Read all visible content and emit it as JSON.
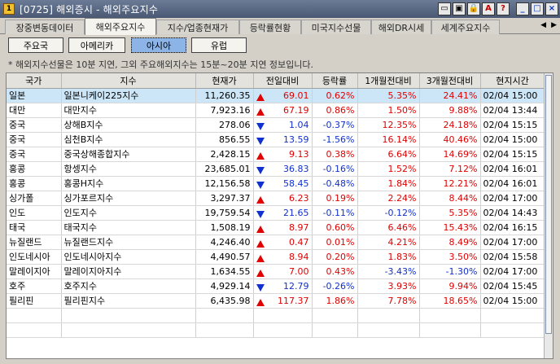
{
  "window": {
    "title": "[0725] 해외증시 - 해외주요지수",
    "icon_label": "1",
    "buttons": [
      "window-icon",
      "window-icon",
      "lock-icon",
      "a-icon",
      "help-icon",
      "minimize-icon",
      "maximize-icon",
      "close-icon"
    ]
  },
  "tabs": [
    {
      "label": "장중변동데이터"
    },
    {
      "label": "해외주요지수"
    },
    {
      "label": "지수/업종현재가"
    },
    {
      "label": "등락률현황"
    },
    {
      "label": "미국지수선물"
    },
    {
      "label": "해외DR시세"
    },
    {
      "label": "세계주요지수"
    }
  ],
  "tab_arrows": {
    "left": "◀",
    "right": "▶"
  },
  "regions": [
    {
      "label": "주요국"
    },
    {
      "label": "아메리카"
    },
    {
      "label": "아시아"
    },
    {
      "label": "유럽"
    }
  ],
  "notice": "* 해외지수선물은 10분 지연, 그외 주요해외지수는 15분~20분 지연 정보입니다.",
  "columns": [
    "국가",
    "지수",
    "현재가",
    "전일대비",
    "등락률",
    "1개월전대비",
    "3개월전대비",
    "현지시간"
  ],
  "rows": [
    {
      "country": "일본",
      "index": "일본니케이225지수",
      "price": "11,260.35",
      "dir": "up",
      "change": "69.01",
      "rate": "0.62%",
      "m1": "5.35%",
      "m3": "24.41%",
      "date": "02/04",
      "time": "15:00"
    },
    {
      "country": "대만",
      "index": "대만지수",
      "price": "7,923.16",
      "dir": "up",
      "change": "67.19",
      "rate": "0.86%",
      "m1": "1.50%",
      "m3": "9.88%",
      "date": "02/04",
      "time": "13:44"
    },
    {
      "country": "중국",
      "index": "상해B지수",
      "price": "278.06",
      "dir": "dn",
      "change": "1.04",
      "rate": "-0.37%",
      "m1": "12.35%",
      "m3": "24.18%",
      "date": "02/04",
      "time": "15:15"
    },
    {
      "country": "중국",
      "index": "심천B지수",
      "price": "856.55",
      "dir": "dn",
      "change": "13.59",
      "rate": "-1.56%",
      "m1": "16.14%",
      "m3": "40.46%",
      "date": "02/04",
      "time": "15:00"
    },
    {
      "country": "중국",
      "index": "중국상해종합지수",
      "price": "2,428.15",
      "dir": "up",
      "change": "9.13",
      "rate": "0.38%",
      "m1": "6.64%",
      "m3": "14.69%",
      "date": "02/04",
      "time": "15:15"
    },
    {
      "country": "홍콩",
      "index": "항셍지수",
      "price": "23,685.01",
      "dir": "dn",
      "change": "36.83",
      "rate": "-0.16%",
      "m1": "1.52%",
      "m3": "7.12%",
      "date": "02/04",
      "time": "16:01"
    },
    {
      "country": "홍콩",
      "index": "홍콩H지수",
      "price": "12,156.58",
      "dir": "dn",
      "change": "58.45",
      "rate": "-0.48%",
      "m1": "1.84%",
      "m3": "12.21%",
      "date": "02/04",
      "time": "16:01"
    },
    {
      "country": "싱가폴",
      "index": "싱가포르지수",
      "price": "3,297.37",
      "dir": "up",
      "change": "6.23",
      "rate": "0.19%",
      "m1": "2.24%",
      "m3": "8.44%",
      "date": "02/04",
      "time": "17:00"
    },
    {
      "country": "인도",
      "index": "인도지수",
      "price": "19,759.54",
      "dir": "dn",
      "change": "21.65",
      "rate": "-0.11%",
      "m1": "-0.12%",
      "m3": "5.35%",
      "date": "02/04",
      "time": "14:43"
    },
    {
      "country": "태국",
      "index": "태국지수",
      "price": "1,508.19",
      "dir": "up",
      "change": "8.97",
      "rate": "0.60%",
      "m1": "6.46%",
      "m3": "15.43%",
      "date": "02/04",
      "time": "16:15"
    },
    {
      "country": "뉴질랜드",
      "index": "뉴질랜드지수",
      "price": "4,246.40",
      "dir": "up",
      "change": "0.47",
      "rate": "0.01%",
      "m1": "4.21%",
      "m3": "8.49%",
      "date": "02/04",
      "time": "17:00"
    },
    {
      "country": "인도네시아",
      "index": "인도네시아지수",
      "price": "4,490.57",
      "dir": "up",
      "change": "8.94",
      "rate": "0.20%",
      "m1": "1.83%",
      "m3": "3.50%",
      "date": "02/04",
      "time": "15:58"
    },
    {
      "country": "말레이지아",
      "index": "말레이지아지수",
      "price": "1,634.55",
      "dir": "up",
      "change": "7.00",
      "rate": "0.43%",
      "m1": "-3.43%",
      "m3": "-1.30%",
      "date": "02/04",
      "time": "17:00"
    },
    {
      "country": "호주",
      "index": "호주지수",
      "price": "4,929.14",
      "dir": "dn",
      "change": "12.79",
      "rate": "-0.26%",
      "m1": "3.93%",
      "m3": "9.94%",
      "date": "02/04",
      "time": "15:45"
    },
    {
      "country": "필리핀",
      "index": "필리핀지수",
      "price": "6,435.98",
      "dir": "up",
      "change": "117.37",
      "rate": "1.86%",
      "m1": "7.78%",
      "m3": "18.65%",
      "date": "02/04",
      "time": "15:00"
    }
  ],
  "colors": {
    "up": "#e00000",
    "down": "#1030d0",
    "selected_row": "#cde6f7",
    "active_region": "#8cb4e6"
  }
}
